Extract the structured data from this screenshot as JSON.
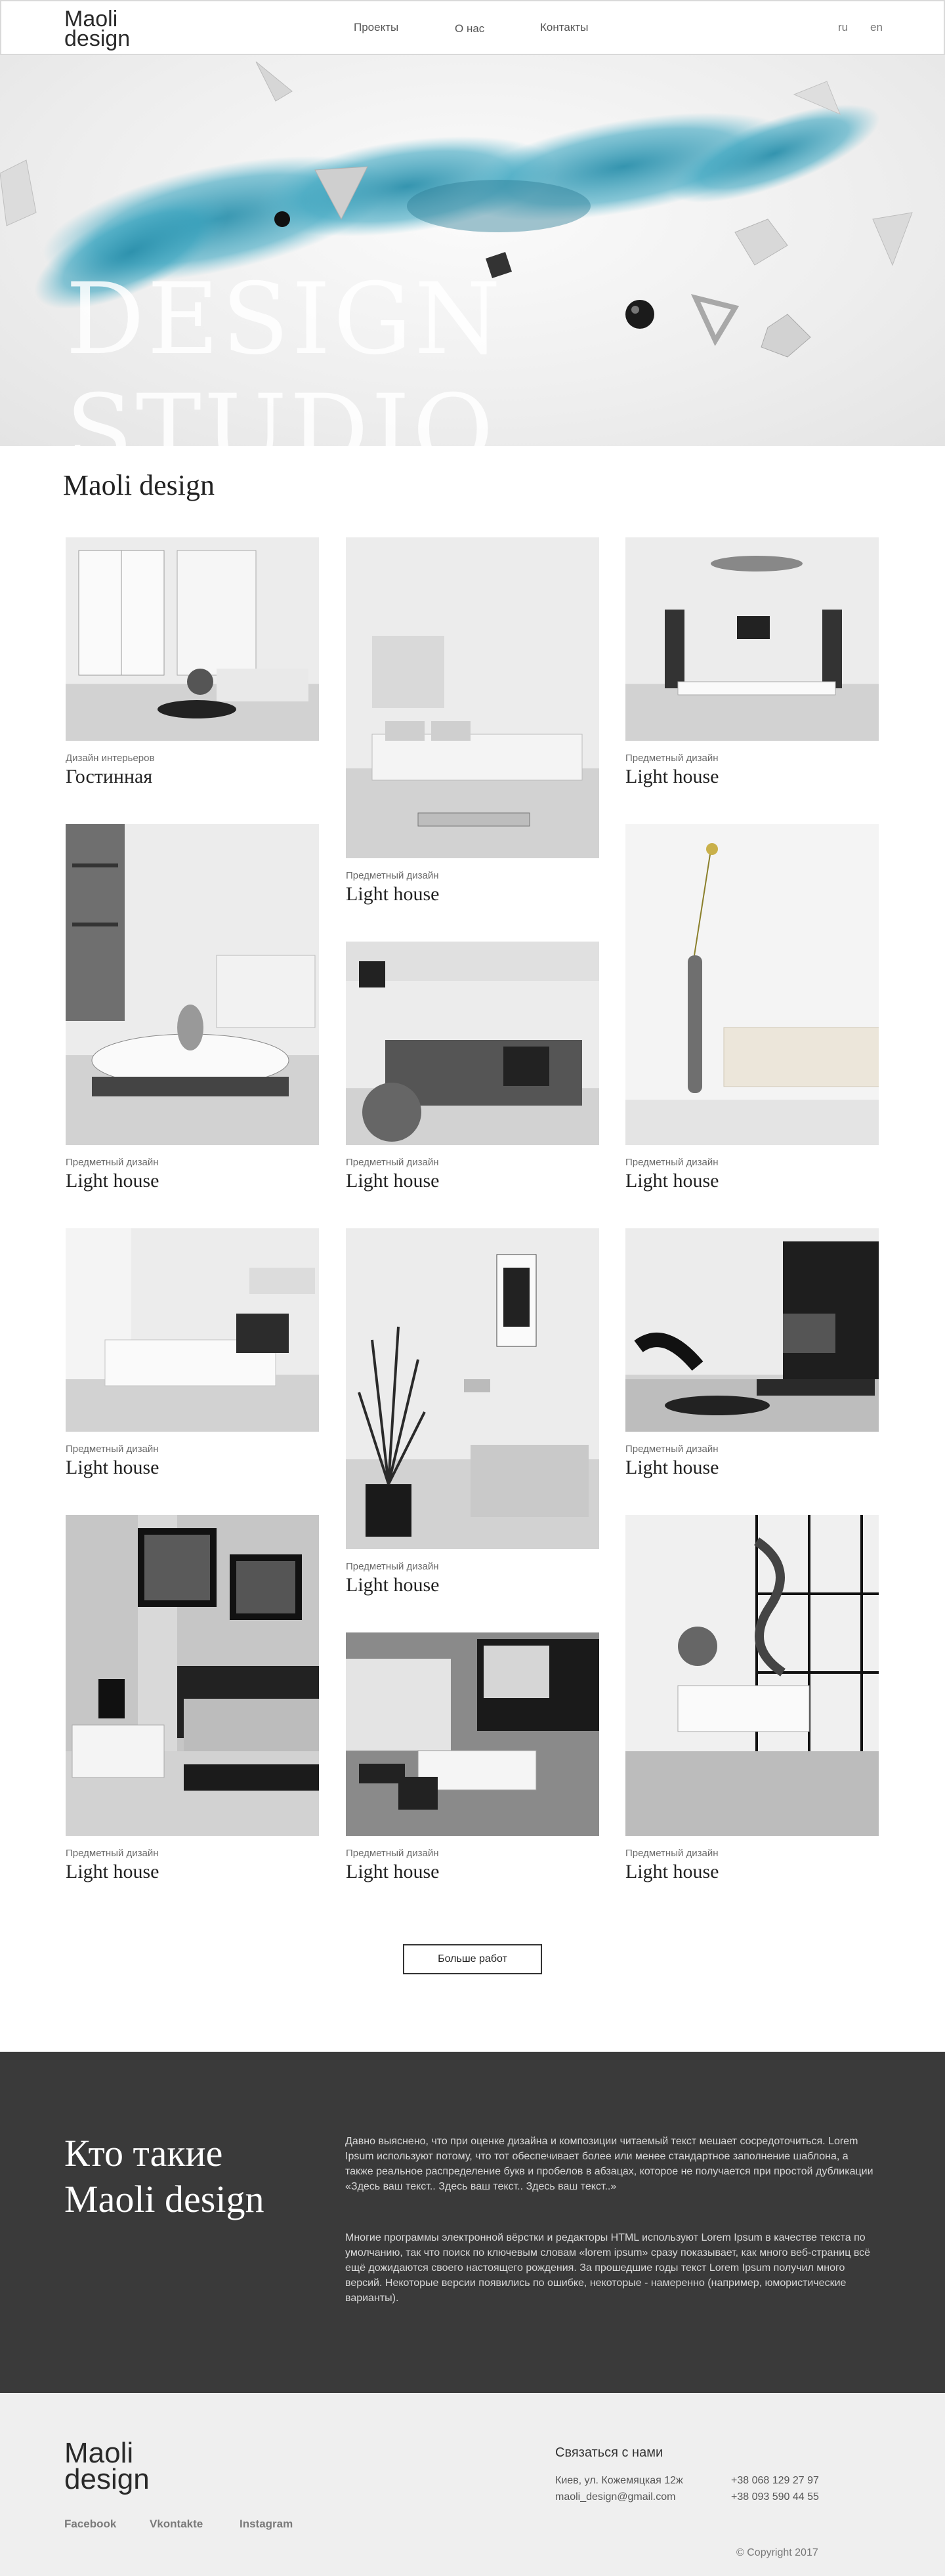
{
  "header": {
    "logo_line1": "Maoli",
    "logo_line2": "design",
    "nav": [
      "Проекты",
      "О нас",
      "Контакты"
    ],
    "langs": [
      "ru",
      "en"
    ]
  },
  "hero": {
    "title_line1": "DESIGN",
    "title_line2": "STUDIO",
    "splash_color": "#2a8fab"
  },
  "portfolio": {
    "title": "Maoli design",
    "cards": [
      {
        "category": "Дизайн интерьеров",
        "title": "Гостинная"
      },
      {
        "category": "Предметный дизайн",
        "title": "Light house"
      },
      {
        "category": "Предметный дизайн",
        "title": "Light house"
      },
      {
        "category": "Предметный дизайн",
        "title": "Light house"
      },
      {
        "category": "Предметный дизайн",
        "title": "Light house"
      },
      {
        "category": "Предметный дизайн",
        "title": "Light house"
      },
      {
        "category": "Предметный дизайн",
        "title": "Light house"
      },
      {
        "category": "Предметный дизайн",
        "title": "Light house"
      },
      {
        "category": "Предметный дизайн",
        "title": "Light house"
      },
      {
        "category": "Предметный дизайн",
        "title": "Light house"
      },
      {
        "category": "Предметный дизайн",
        "title": "Light house"
      },
      {
        "category": "Предметный дизайн",
        "title": "Light house"
      }
    ],
    "more_label": "Больше работ"
  },
  "about": {
    "title_line1": "Кто такие",
    "title_line2": "Maoli design",
    "paragraph1": "Давно выяснено, что при оценке дизайна и композиции читаемый текст мешает сосредоточиться. Lorem Ipsum используют потому, что тот обеспечивает более или менее стандартное заполнение шаблона, а также реальное распределение букв и пробелов в абзацах, которое не получается при простой дубликации «Здесь ваш текст.. Здесь ваш текст.. Здесь ваш текст..»",
    "paragraph2": "Многие программы электронной вёрстки и редакторы HTML используют Lorem Ipsum в качестве текста по умолчанию, так что поиск по ключевым словам «lorem ipsum» сразу показывает, как много веб-страниц всё ещё дожидаются своего настоящего рождения. За прошедшие годы текст Lorem Ipsum получил много версий. Некоторые версии появились по ошибке, некоторые - намеренно (например, юмористические варианты)."
  },
  "footer": {
    "logo_line1": "Maoli",
    "logo_line2": "design",
    "social": [
      "Facebook",
      "Vkontakte",
      "Instagram"
    ],
    "contact_title": "Связаться с нами",
    "address": "Киев, ул. Кожемяцкая 12ж",
    "email": "maoli_design@gmail.com",
    "phone1": "+38 068 129 27 97",
    "phone2": "+38 093 590 44 55",
    "copyright": "© Copyright 2017"
  }
}
